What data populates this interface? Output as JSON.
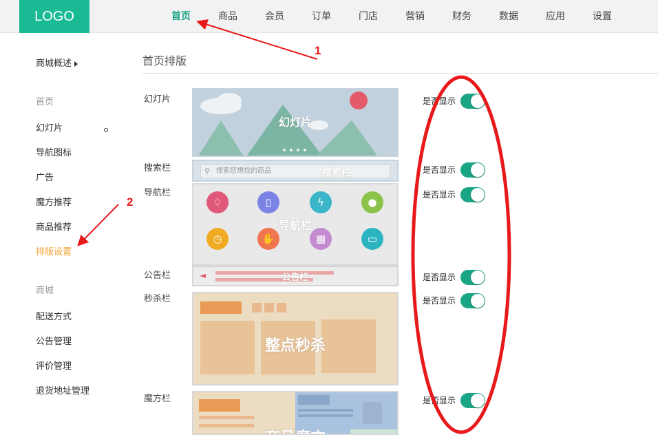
{
  "logo": "LOGO",
  "nav": [
    "首页",
    "商品",
    "会员",
    "订单",
    "门店",
    "营销",
    "财务",
    "数据",
    "应用",
    "设置"
  ],
  "sidebar": {
    "overview": "商城概述",
    "group_home": "首页",
    "home_items": [
      "幻灯片",
      "导航图标",
      "广告",
      "魔方推荐",
      "商品推荐",
      "排版设置"
    ],
    "group_mall": "商城",
    "mall_items": [
      "配送方式",
      "公告管理",
      "评价管理",
      "退货地址管理"
    ]
  },
  "page_title": "首页排版",
  "rows": {
    "slide": "幻灯片",
    "search": "搜索栏",
    "nav": "导航栏",
    "notice": "公告栏",
    "seckill": "秒杀栏",
    "magic": "魔方栏"
  },
  "previews": {
    "slide": "幻灯片",
    "search": "搜索栏",
    "search_placeholder": "搜索您想找的商品",
    "nav": "导航栏",
    "notice": "公告栏",
    "seckill": "整点秒杀",
    "magic": "商品魔方"
  },
  "show_label": "是否显示",
  "toggles": {
    "slide": true,
    "search": true,
    "nav": true,
    "notice": true,
    "seckill": true,
    "magic": true
  },
  "annotations": [
    "1",
    "2"
  ],
  "colors": {
    "brand": "#1aba94",
    "active_nav": "#1aa686",
    "active_side": "#f3a12d",
    "annotation": "#e8191b"
  },
  "nav_icons": [
    {
      "name": "tag-icon",
      "color": "#e0597a"
    },
    {
      "name": "phone-icon",
      "color": "#7b83e5"
    },
    {
      "name": "lightning-icon",
      "color": "#3bb6c9"
    },
    {
      "name": "apple-icon",
      "color": "#8cc34a"
    },
    {
      "name": "alarm-icon",
      "color": "#f0ab22"
    },
    {
      "name": "thumb-up-icon",
      "color": "#f07650"
    },
    {
      "name": "gift-icon",
      "color": "#c48bd1"
    },
    {
      "name": "truck-icon",
      "color": "#2bb3c0"
    }
  ]
}
